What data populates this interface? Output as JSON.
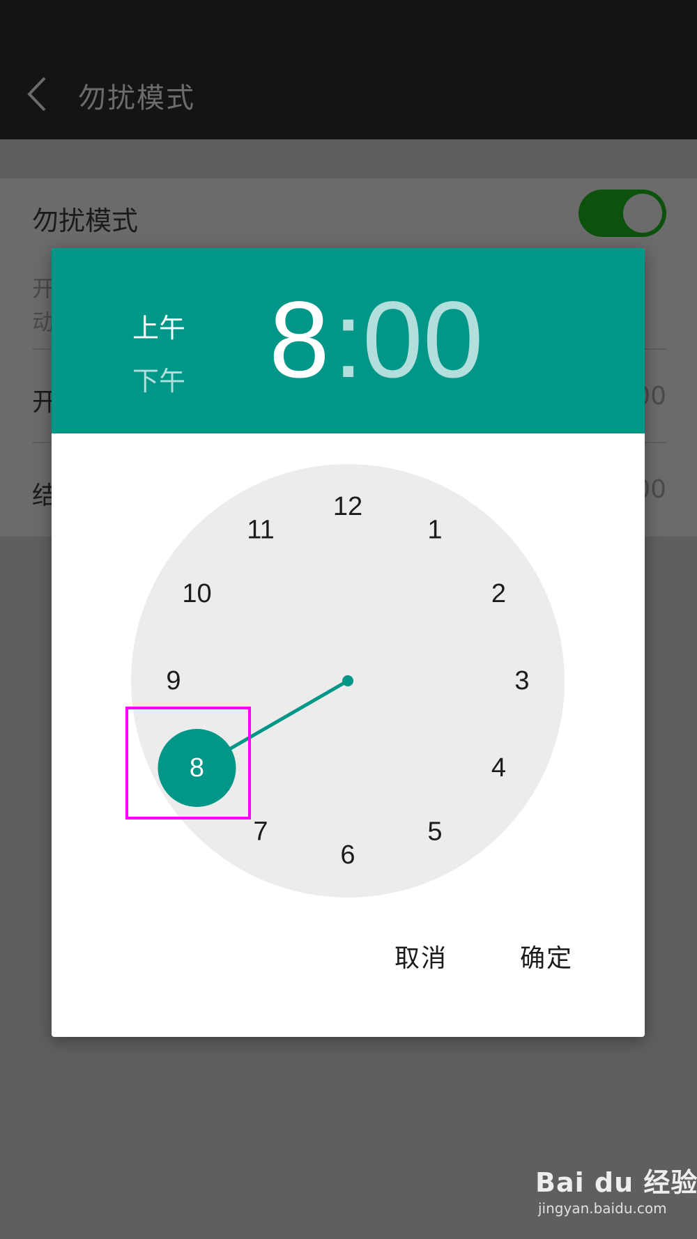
{
  "topbar": {
    "title": "勿扰模式",
    "back_icon": "chevron-left-icon"
  },
  "settings": {
    "dnd_label": "勿扰模式",
    "dnd_toggle_on": true,
    "desc_partial": "开动",
    "start_label": "开",
    "start_value": "00",
    "end_label": "结",
    "end_value": "00"
  },
  "dialog": {
    "am_label": "上午",
    "pm_label": "下午",
    "selected_period": "上午",
    "hour": "8",
    "separator": ":",
    "minute": "00",
    "clock_numbers": [
      "12",
      "1",
      "2",
      "3",
      "4",
      "5",
      "6",
      "7",
      "8",
      "9",
      "10",
      "11"
    ],
    "selected_hour": 8,
    "cancel_label": "取消",
    "ok_label": "确定"
  },
  "colors": {
    "accent": "#009688",
    "accent_light": "#b2dfdb",
    "clock_face": "#ececec",
    "highlight": "#ff00ff",
    "toggle_on": "#0c520c"
  },
  "watermark": {
    "logo": "Bai du 经验",
    "url": "jingyan.baidu.com"
  }
}
